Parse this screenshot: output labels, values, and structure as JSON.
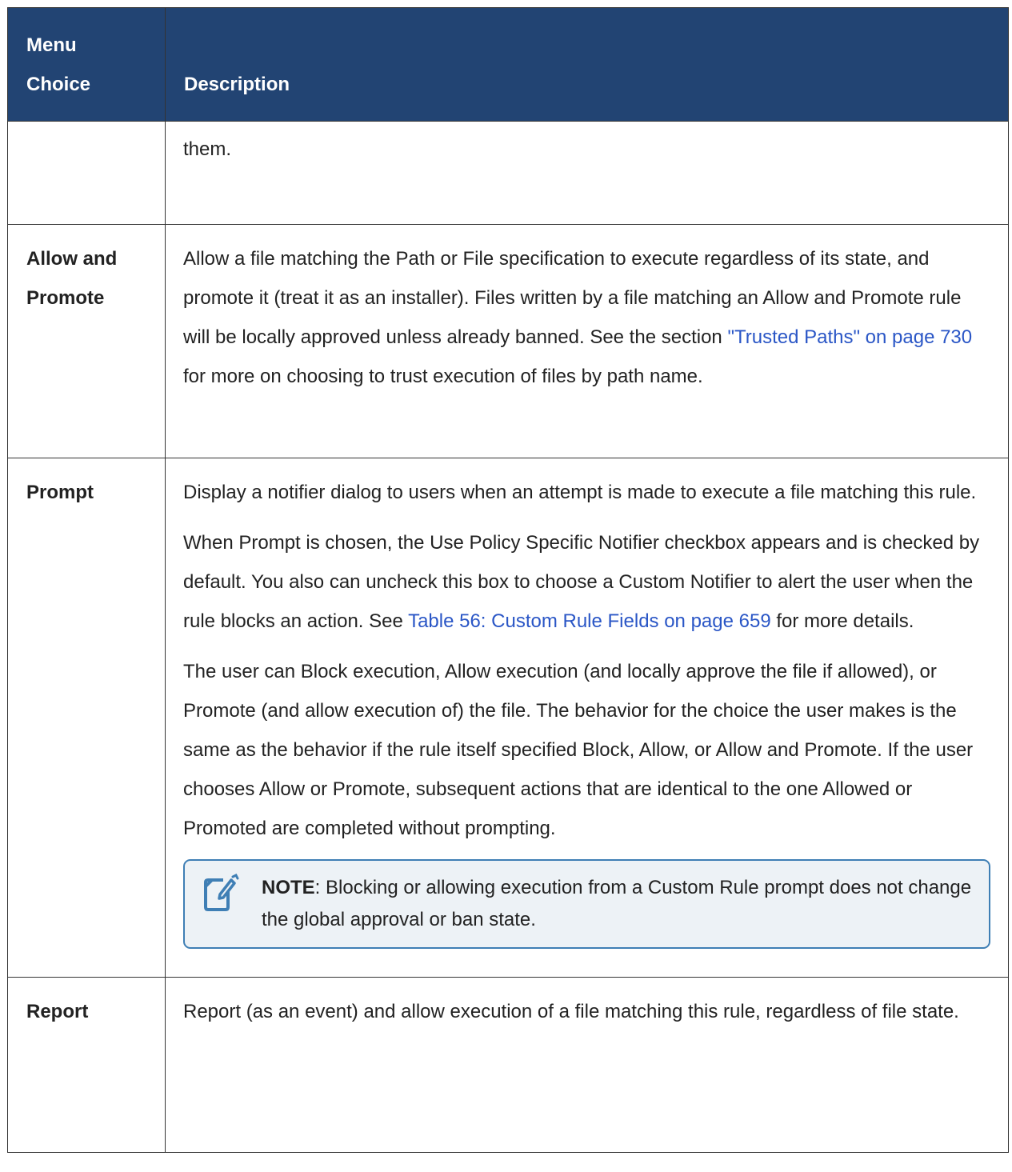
{
  "header": {
    "col1_line1": "Menu",
    "col1_line2": "Choice",
    "col2": "Description"
  },
  "rows": [
    {
      "choice": "",
      "paragraphs": [
        "them."
      ]
    },
    {
      "choice_line1": "Allow and",
      "choice_line2": "Promote",
      "p1_pre": "Allow a file matching the Path or File specification to execute regardless of its state, and promote it (treat it as an installer). Files written by a file matching an Allow and Promote rule will be locally approved unless already banned. See the section ",
      "p1_link": "\"Trusted Paths\" on page 730",
      "p1_post": " for more on choosing to trust execution of files by path name."
    },
    {
      "choice": "Prompt",
      "p1": "Display a notifier dialog to users when an attempt is made to execute a file matching this rule.",
      "p2_pre": "When Prompt is chosen, the Use Policy Specific Notifier checkbox appears and is checked by default. You also can uncheck this box to choose a Custom Notifier to alert the user when the rule blocks an action. See ",
      "p2_link": "Table 56: Custom Rule Fields on page 659",
      "p2_post": " for more details.",
      "p3": "The user can Block execution, Allow execution (and locally approve the file if allowed), or Promote (and allow execution of) the file. The behavior for the choice the user makes is the same as the behavior if the rule itself specified Block, Allow, or Allow and Promote. If the user chooses Allow or Promote, subsequent actions that are identical to the one Allowed or Promoted are completed without prompting.",
      "note": {
        "icon": "note-pencil-icon",
        "label": "NOTE",
        "text": ": Blocking or allowing execution from a Custom Rule prompt does not change the global approval or ban state."
      }
    },
    {
      "choice": "Report",
      "p1": "Report (as an event) and allow execution of a file matching this rule, regardless of file state."
    }
  ],
  "colors": {
    "header_bg": "#224473",
    "link": "#2a56c6",
    "note_border": "#3f7fb5",
    "note_bg": "#edf2f6"
  }
}
